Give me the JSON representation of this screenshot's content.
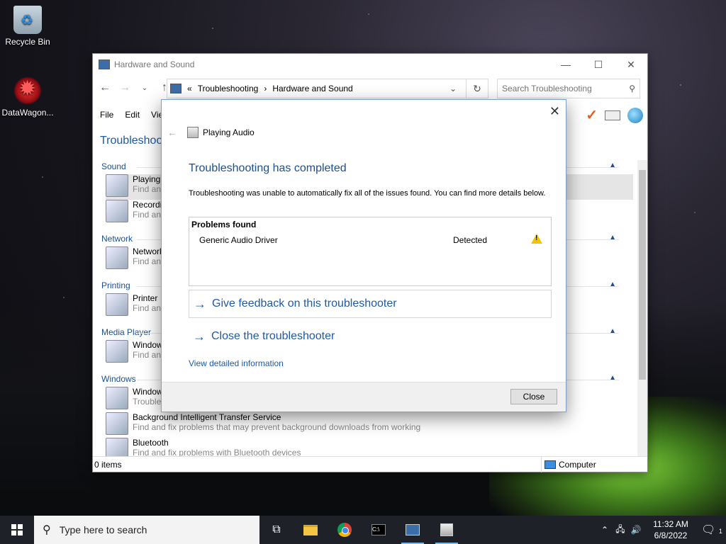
{
  "desktop": {
    "icons": [
      {
        "label": "Recycle Bin"
      },
      {
        "label": "DataWagon..."
      }
    ]
  },
  "explorer": {
    "title": "Hardware and Sound",
    "breadcrumb": {
      "prefix": "«",
      "parts": [
        "Troubleshooting",
        "Hardware and Sound"
      ]
    },
    "search_placeholder": "Search Troubleshooting",
    "menu": [
      "File",
      "Edit",
      "Vie"
    ],
    "page_title": "Troubleshoo",
    "categories": [
      {
        "name": "Sound",
        "items": [
          {
            "name": "Playing",
            "desc": "Find and"
          },
          {
            "name": "Recordi",
            "desc": "Find and"
          }
        ]
      },
      {
        "name": "Network",
        "items": [
          {
            "name": "Network",
            "desc": "Find and"
          }
        ]
      },
      {
        "name": "Printing",
        "items": [
          {
            "name": "Printer",
            "desc": "Find and"
          }
        ]
      },
      {
        "name": "Media Player",
        "items": [
          {
            "name": "Window",
            "desc": "Find and"
          }
        ]
      },
      {
        "name": "Windows",
        "items": [
          {
            "name": "Window",
            "desc": "Troubles"
          },
          {
            "name": "Background Intelligent Transfer Service",
            "desc": "Find and fix problems that may prevent background downloads from working"
          },
          {
            "name": "Bluetooth",
            "desc": "Find and fix problems with Bluetooth devices"
          }
        ]
      }
    ],
    "status": {
      "items": "0 items",
      "location": "Computer"
    }
  },
  "dialog": {
    "header": "Playing Audio",
    "heading": "Troubleshooting has completed",
    "description": "Troubleshooting was unable to automatically fix all of the issues found. You can find more details below.",
    "problems": {
      "header": "Problems found",
      "rows": [
        {
          "name": "Generic Audio Driver",
          "status": "Detected",
          "icon": "warning-icon"
        }
      ]
    },
    "link_feedback": "Give feedback on this troubleshooter",
    "link_close": "Close the troubleshooter",
    "detail_link": "View detailed information",
    "close_button": "Close"
  },
  "taskbar": {
    "search_placeholder": "Type here to search",
    "time": "11:32 AM",
    "date": "6/8/2022",
    "notification_count": "1"
  }
}
